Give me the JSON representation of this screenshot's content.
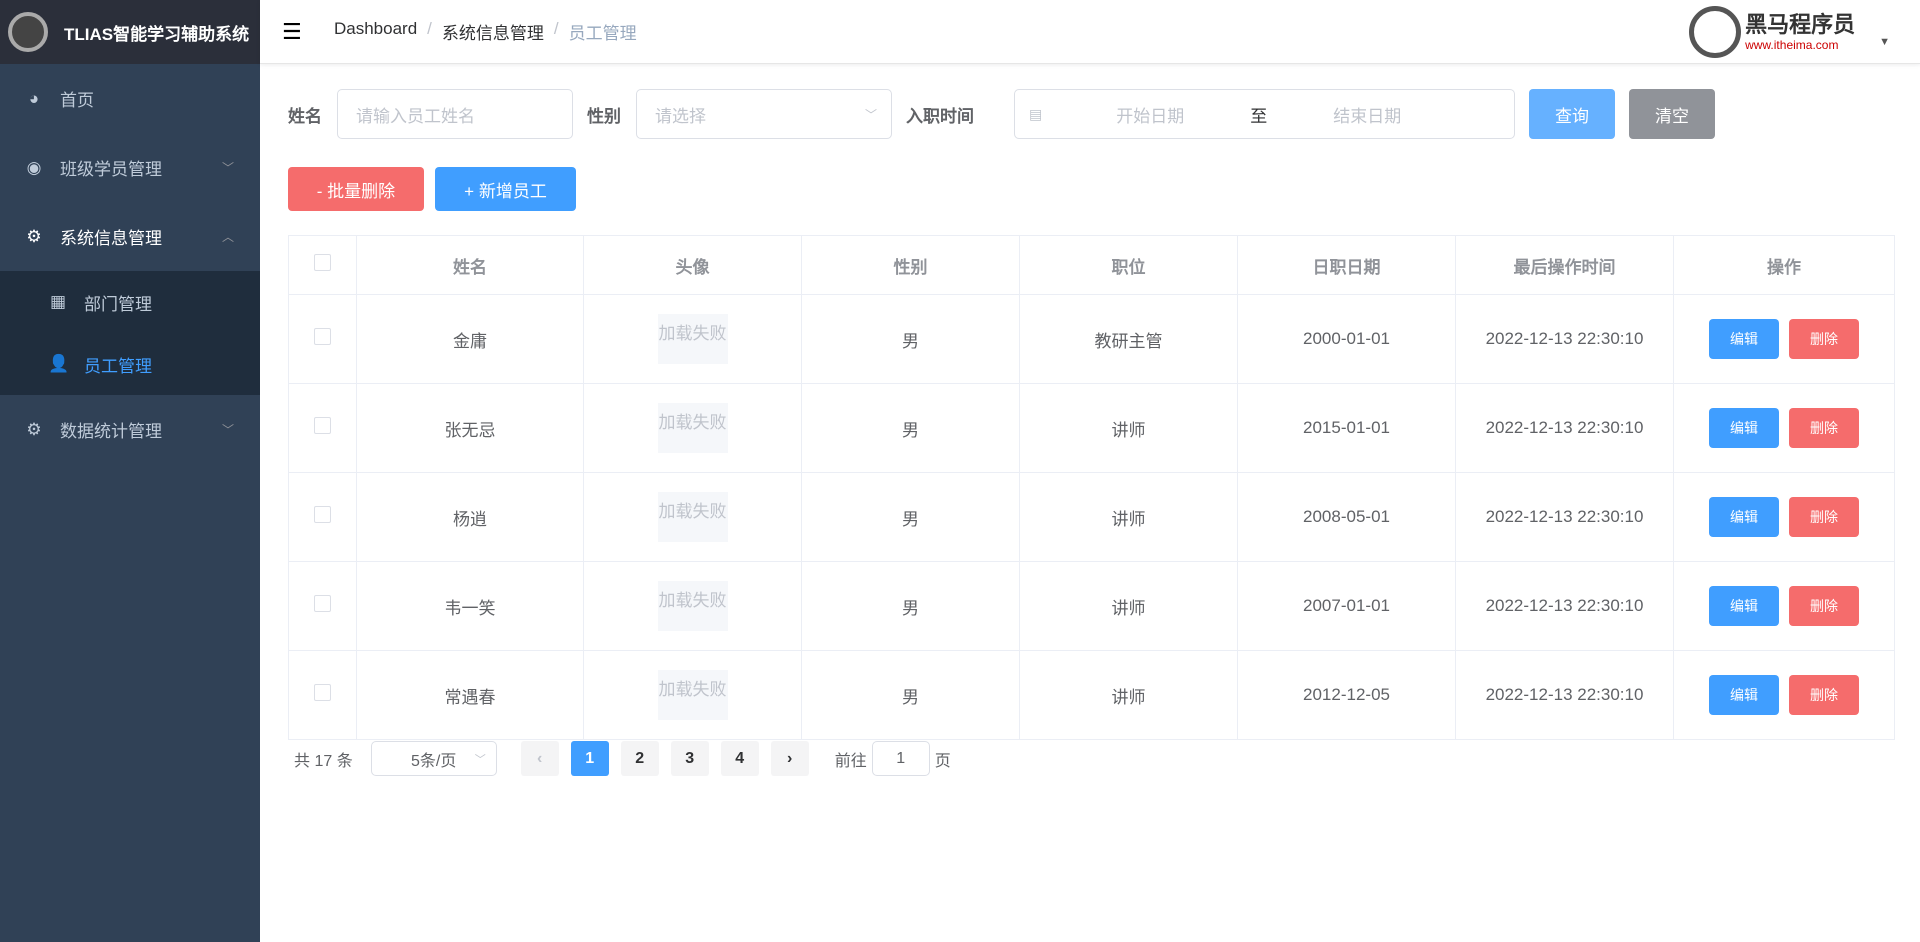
{
  "app": {
    "title": "TLIAS智能学习辅助系统"
  },
  "sidebar": {
    "items": [
      {
        "label": "首页",
        "icon": "dashboard-icon"
      },
      {
        "label": "班级学员管理",
        "icon": "help-circle-icon"
      },
      {
        "label": "系统信息管理",
        "icon": "gear-icon"
      },
      {
        "label": "部门管理",
        "icon": "grid-icon"
      },
      {
        "label": "员工管理",
        "icon": "user-icon"
      },
      {
        "label": "数据统计管理",
        "icon": "gear-icon"
      }
    ]
  },
  "header": {
    "breadcrumb": [
      "Dashboard",
      "系统信息管理",
      "员工管理"
    ],
    "brand_name": "黑马程序员",
    "brand_url": "www.itheima.com"
  },
  "search": {
    "name_label": "姓名",
    "name_placeholder": "请输入员工姓名",
    "gender_label": "性别",
    "gender_placeholder": "请选择",
    "date_label": "入职时间",
    "start_placeholder": "开始日期",
    "range_sep": "至",
    "end_placeholder": "结束日期",
    "query": "查询",
    "clear": "清空"
  },
  "actions": {
    "batch_delete": "- 批量删除",
    "add": "+ 新增员工"
  },
  "table": {
    "headers": [
      "姓名",
      "头像",
      "性别",
      "职位",
      "日职日期",
      "最后操作时间",
      "操作"
    ],
    "img_fail": "加载失败",
    "edit": "编辑",
    "delete": "删除",
    "rows": [
      {
        "name": "金庸",
        "gender": "男",
        "job": "教研主管",
        "entry": "2000-01-01",
        "updated": "2022-12-13 22:30:10"
      },
      {
        "name": "张无忌",
        "gender": "男",
        "job": "讲师",
        "entry": "2015-01-01",
        "updated": "2022-12-13 22:30:10"
      },
      {
        "name": "杨逍",
        "gender": "男",
        "job": "讲师",
        "entry": "2008-05-01",
        "updated": "2022-12-13 22:30:10"
      },
      {
        "name": "韦一笑",
        "gender": "男",
        "job": "讲师",
        "entry": "2007-01-01",
        "updated": "2022-12-13 22:30:10"
      },
      {
        "name": "常遇春",
        "gender": "男",
        "job": "讲师",
        "entry": "2012-12-05",
        "updated": "2022-12-13 22:30:10"
      }
    ]
  },
  "pagination": {
    "total": "共 17 条",
    "page_size": "5条/页",
    "pages": [
      "1",
      "2",
      "3",
      "4"
    ],
    "goto_label": "前往",
    "goto_value": "1",
    "goto_suffix": "页"
  },
  "colors": {
    "primary": "#409eff",
    "danger": "#f56c6c",
    "sidebar": "#304156"
  }
}
